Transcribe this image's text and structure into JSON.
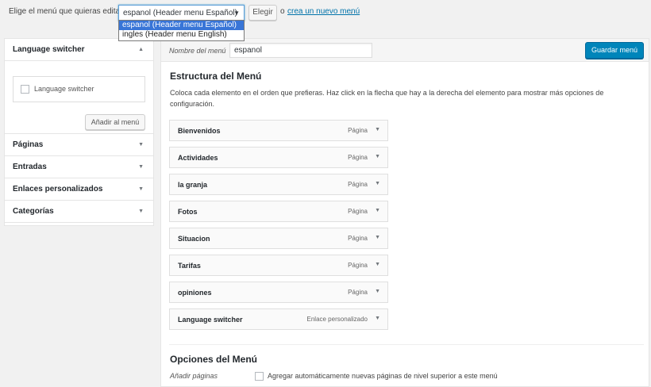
{
  "manage": {
    "label": "Elige el menú que quieras editar:",
    "selected": "espanol (Header menu Español)",
    "arrow": "▼",
    "choose_button": "Elegir",
    "or_text": "o",
    "create_link": "crea un nuevo menú",
    "create_link_suffix": ".",
    "options": [
      "espanol (Header menu Español)",
      "ingles (Header menu English)"
    ],
    "selected_index": 0
  },
  "sidebar": {
    "open_section": {
      "title": "Language switcher",
      "arrow": "▲",
      "checkbox_label": "Language switcher",
      "checked": false,
      "add_button": "Añadir al menú"
    },
    "sections": [
      {
        "title": "Páginas",
        "arrow": "▼"
      },
      {
        "title": "Entradas",
        "arrow": "▼"
      },
      {
        "title": "Enlaces personalizados",
        "arrow": "▼"
      },
      {
        "title": "Categorías",
        "arrow": "▼"
      }
    ]
  },
  "main": {
    "name_label": "Nombre del menú",
    "name_value": "espanol",
    "save_button": "Guardar menú",
    "structure_title": "Estructura del Menú",
    "structure_desc": "Coloca cada elemento en el orden que prefieras. Haz click en la flecha que hay a la derecha del elemento para mostrar más opciones de configuración.",
    "items": [
      {
        "title": "Bienvenidos",
        "type": "Página",
        "arrow": "▼"
      },
      {
        "title": "Actividades",
        "type": "Página",
        "arrow": "▼"
      },
      {
        "title": "la granja",
        "type": "Página",
        "arrow": "▼"
      },
      {
        "title": "Fotos",
        "type": "Página",
        "arrow": "▼"
      },
      {
        "title": "Situacion",
        "type": "Página",
        "arrow": "▼"
      },
      {
        "title": "Tarifas",
        "type": "Página",
        "arrow": "▼"
      },
      {
        "title": "opiniones",
        "type": "Página",
        "arrow": "▼"
      },
      {
        "title": "Language switcher",
        "type": "Enlace personalizado",
        "arrow": "▼"
      }
    ],
    "options_title": "Opciones del Menú",
    "auto_add_label": "Añadir páginas",
    "auto_add_checkbox": "Agregar automáticamente nuevas páginas de nivel superior a este menú",
    "auto_add_checked": false
  }
}
